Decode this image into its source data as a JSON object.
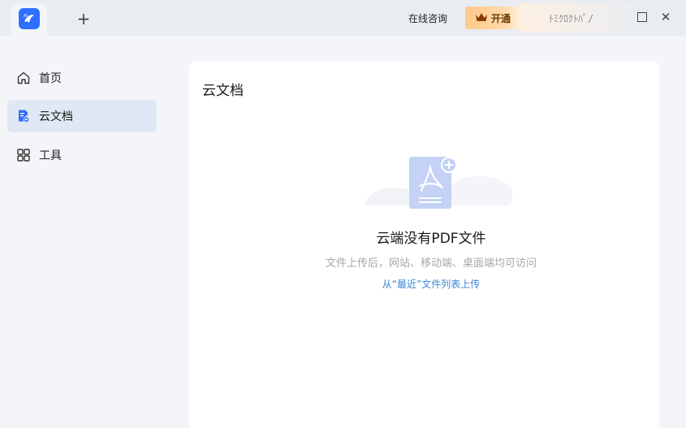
{
  "titlebar": {
    "new_tab_label": "+",
    "consult_label": "在线咨询",
    "vip_label": "开通",
    "garbled_text": "ﾄﾐｸﾛｸﾄﾊﾟ/",
    "close_label": "✕"
  },
  "sidebar": {
    "items": [
      {
        "label": "首页",
        "icon": "home-icon"
      },
      {
        "label": "云文档",
        "icon": "cloud-doc-icon",
        "active": true
      },
      {
        "label": "工具",
        "icon": "grid-icon"
      }
    ]
  },
  "main": {
    "title": "云文档",
    "empty": {
      "title": "云端没有PDF文件",
      "description": "文件上传后，网站、移动端、桌面端均可访问",
      "link": "从“最近”文件列表上传"
    }
  },
  "colors": {
    "accent": "#2f6fff",
    "link": "#3a86d6",
    "vip_gold": "#ffc98a"
  }
}
